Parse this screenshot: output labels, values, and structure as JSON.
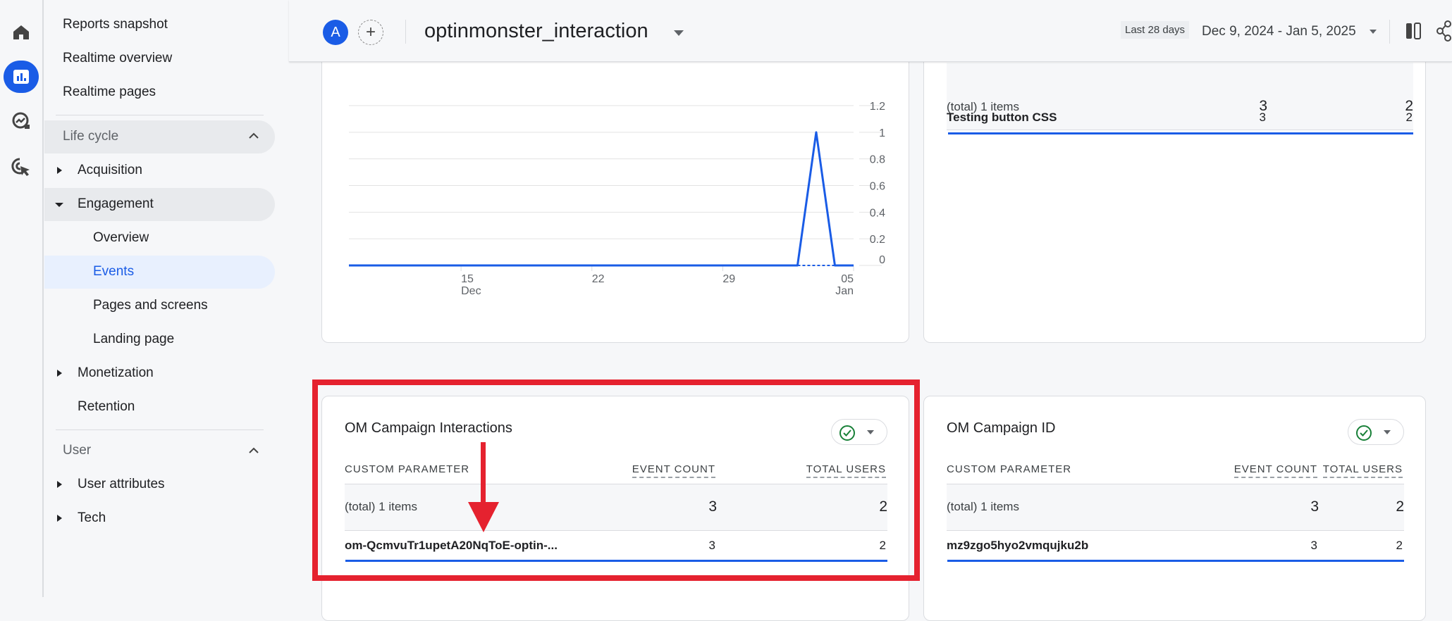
{
  "rail": {
    "icons": [
      "home-icon",
      "reports-icon",
      "explore-icon",
      "advertising-icon"
    ]
  },
  "nav": {
    "top_items": [
      "Reports snapshot",
      "Realtime overview",
      "Realtime pages"
    ],
    "lifecycle": {
      "label": "Life cycle",
      "items": [
        "Acquisition",
        "Engagement",
        "Monetization",
        "Retention"
      ],
      "engagement_sub": [
        "Overview",
        "Events",
        "Pages and screens",
        "Landing page"
      ],
      "active": "Events"
    },
    "user": {
      "label": "User",
      "items": [
        "User attributes",
        "Tech"
      ]
    }
  },
  "header": {
    "avatar_letter": "A",
    "title": "optinmonster_interaction",
    "date_chip": "Last 28 days",
    "date_range": "Dec 9, 2024 - Jan 5, 2025"
  },
  "colors": {
    "accent": "#1a5ce6",
    "highlight": "#e24",
    "check": "#188038"
  },
  "chart_data": {
    "type": "line",
    "x": [
      "2024-12-09",
      "2024-12-10",
      "2024-12-11",
      "2024-12-12",
      "2024-12-13",
      "2024-12-14",
      "2024-12-15",
      "2024-12-16",
      "2024-12-17",
      "2024-12-18",
      "2024-12-19",
      "2024-12-20",
      "2024-12-21",
      "2024-12-22",
      "2024-12-23",
      "2024-12-24",
      "2024-12-25",
      "2024-12-26",
      "2024-12-27",
      "2024-12-28",
      "2024-12-29",
      "2024-12-30",
      "2024-12-31",
      "2025-01-01",
      "2025-01-02",
      "2025-01-03",
      "2025-01-04",
      "2025-01-05"
    ],
    "values": [
      0,
      0,
      0,
      0,
      0,
      0,
      0,
      0,
      0,
      0,
      0,
      0,
      0,
      0,
      0,
      0,
      0,
      0,
      0,
      0,
      0,
      0,
      0,
      0,
      0,
      1,
      0,
      0
    ],
    "ylim": [
      0,
      1.2
    ],
    "yticks": [
      "1.2",
      "1",
      "0.8",
      "0.6",
      "0.4",
      "0.2",
      "0"
    ],
    "yvals": [
      1.2,
      1,
      0.8,
      0.6,
      0.4,
      0.2,
      0
    ],
    "xticks": [
      {
        "day": "15",
        "month": "Dec",
        "date": "2024-12-15"
      },
      {
        "day": "22",
        "month": "",
        "date": "2024-12-22"
      },
      {
        "day": "29",
        "month": "",
        "date": "2024-12-29"
      },
      {
        "day": "05",
        "month": "Jan",
        "date": "2025-01-05"
      }
    ],
    "grid": true,
    "yaxis_side": "right"
  },
  "top_right_card": {
    "total": {
      "label": "(total) 1 items",
      "event_count": "3",
      "total_users": "2"
    },
    "rows": [
      {
        "label": "Testing button CSS",
        "event_count": "3",
        "total_users": "2"
      }
    ]
  },
  "cards": [
    {
      "title": "OM Campaign Interactions",
      "headers": [
        "CUSTOM PARAMETER",
        "EVENT COUNT",
        "TOTAL USERS"
      ],
      "total": {
        "label": "(total) 1 items",
        "event_count": "3",
        "total_users": "2"
      },
      "rows": [
        {
          "label": "om-QcmvuTr1upetA20NqToE-optin-...",
          "event_count": "3",
          "total_users": "2"
        }
      ]
    },
    {
      "title": "OM Campaign ID",
      "headers": [
        "CUSTOM PARAMETER",
        "EVENT COUNT",
        "TOTAL USERS"
      ],
      "total": {
        "label": "(total) 1 items",
        "event_count": "3",
        "total_users": "2"
      },
      "rows": [
        {
          "label": "mz9zgo5hyo2vmqujku2b",
          "event_count": "3",
          "total_users": "2"
        }
      ]
    }
  ]
}
